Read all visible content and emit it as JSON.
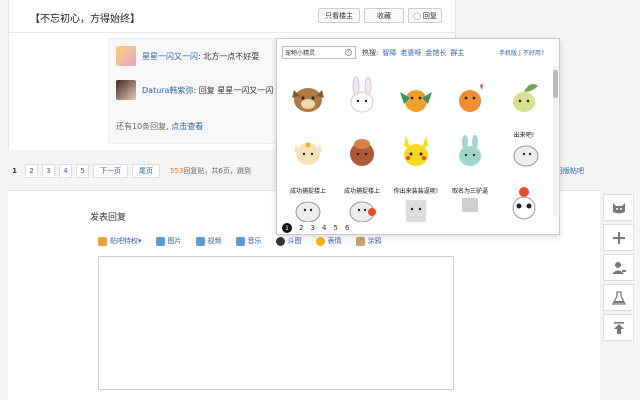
{
  "post": {
    "title": "【不忘初心，方得始终】",
    "only_op_label": "只看楼主",
    "collect_label": "收藏",
    "reply_label": "回复"
  },
  "replies": [
    {
      "name": "星星一闪又一闪",
      "text": ": 北方一点不好耍"
    },
    {
      "name": "Datura韩紫弥",
      "text": ": 回复 星星一闪又一闪 :北"
    }
  ],
  "more": {
    "text": "还有10条回复,",
    "link": "点击查看"
  },
  "pager": {
    "pages": [
      "1",
      "2",
      "3",
      "4",
      "5"
    ],
    "next": "下一页",
    "last": "尾页",
    "count": "553",
    "stat": "回复贴，共6页，跳到"
  },
  "side": {
    "cut_text": "旧版帖吧"
  },
  "reply_box": {
    "title": "发表回复",
    "tools": [
      {
        "label": "贴吧特权",
        "icon": "crown-icon",
        "color": "#e8a23a"
      },
      {
        "label": "图片",
        "icon": "image-icon",
        "color": "#5b9bd5"
      },
      {
        "label": "视频",
        "icon": "video-icon",
        "color": "#5b9bd5"
      },
      {
        "label": "音乐",
        "icon": "music-icon",
        "color": "#5b9bd5"
      },
      {
        "label": "斗图",
        "icon": "meme-icon",
        "color": "#333333"
      },
      {
        "label": "表情",
        "icon": "smile-icon",
        "color": "#f2b705"
      },
      {
        "label": "涂鸦",
        "icon": "brush-icon",
        "color": "#c8a26a"
      }
    ]
  },
  "emoji_panel": {
    "search_value": "宠物小精灵",
    "hot_label": "热搜:",
    "hot_tags": [
      "智障",
      "老婆呀",
      "金馆长",
      "群主"
    ],
    "right_links": "手机版 | 不好用?",
    "captions": [
      "成功捕捉楼上",
      "成功捕捉楼上",
      "你出来装装逼呢!",
      "",
      "出来吧!",
      "",
      "",
      "",
      "取名为三驴逼",
      ""
    ],
    "pages": [
      "1",
      "2",
      "3",
      "4",
      "5",
      "6"
    ]
  },
  "colors": {
    "link": "#2d64b3",
    "accent": "#ff6600"
  }
}
